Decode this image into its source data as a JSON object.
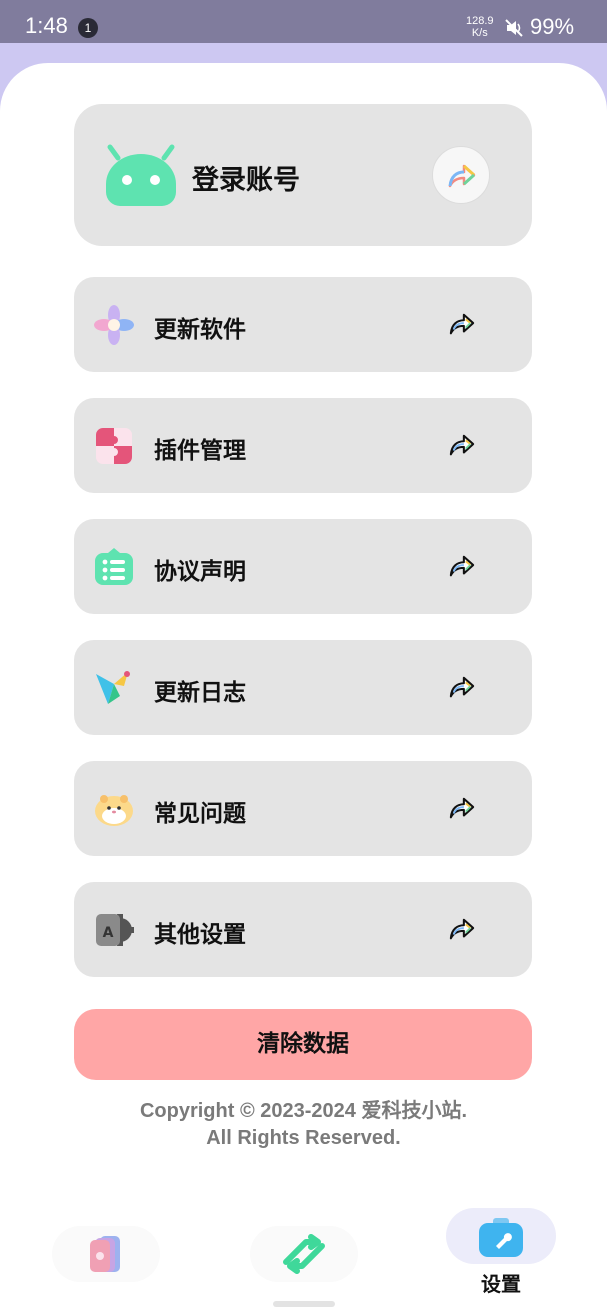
{
  "status_bar": {
    "time": "1:48",
    "notification_count": "1",
    "net_speed_value": "128.9",
    "net_speed_unit": "K/s",
    "battery": "99%"
  },
  "login": {
    "label": "登录账号"
  },
  "menu": {
    "items": [
      {
        "label": "更新软件",
        "icon": "pinwheel-icon"
      },
      {
        "label": "插件管理",
        "icon": "puzzle-icon"
      },
      {
        "label": "协议声明",
        "icon": "list-icon"
      },
      {
        "label": "更新日志",
        "icon": "bird-icon"
      },
      {
        "label": "常见问题",
        "icon": "hamster-icon"
      },
      {
        "label": "其他设置",
        "icon": "translate-gear-icon"
      }
    ]
  },
  "clear_button": {
    "label": "清除数据"
  },
  "footer": {
    "copyright_line1": "Copyright © 2023-2024 爱科技小站.",
    "copyright_line2": "All Rights Reserved."
  },
  "bottom_nav": {
    "settings_label": "设置"
  },
  "colors": {
    "status_bar": "#807c9d",
    "card_bg": "#e4e4e4",
    "clear_button": "#ffa6a6",
    "accent_green": "#5ee3b0"
  }
}
